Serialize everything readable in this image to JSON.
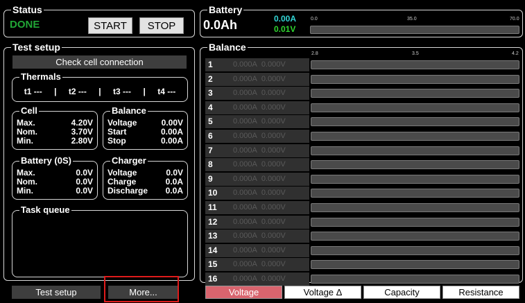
{
  "status": {
    "title": "Status",
    "state": "DONE",
    "start_label": "START",
    "stop_label": "STOP"
  },
  "battery": {
    "title": "Battery",
    "capacity": "0.0Ah",
    "current": "0.00A",
    "voltage": "0.01V",
    "scale": {
      "min": "0.0",
      "mid": "35.0",
      "max": "70.0"
    },
    "colors": {
      "current": "#32d4d4",
      "voltage": "#2fd52f"
    }
  },
  "test_setup": {
    "title": "Test setup",
    "check_button": "Check cell connection",
    "thermals": {
      "title": "Thermals",
      "t1": "t1 ---",
      "t2": "t2 ---",
      "t3": "t3 ---",
      "t4": "t4 ---",
      "sep": "|"
    },
    "cell": {
      "title": "Cell",
      "rows": [
        {
          "k": "Max.",
          "v": "4.20V"
        },
        {
          "k": "Nom.",
          "v": "3.70V"
        },
        {
          "k": "Min.",
          "v": "2.80V"
        }
      ]
    },
    "balance": {
      "title": "Balance",
      "rows": [
        {
          "k": "Voltage",
          "v": "0.00V"
        },
        {
          "k": "Start",
          "v": "0.00A"
        },
        {
          "k": "Stop",
          "v": "0.00A"
        }
      ]
    },
    "battery_cfg": {
      "title": "Battery (0S)",
      "rows": [
        {
          "k": "Max.",
          "v": "0.0V"
        },
        {
          "k": "Nom.",
          "v": "0.0V"
        },
        {
          "k": "Min.",
          "v": "0.0V"
        }
      ]
    },
    "charger": {
      "title": "Charger",
      "rows": [
        {
          "k": "Voltage",
          "v": "0.0V"
        },
        {
          "k": "Charge",
          "v": "0.0A"
        },
        {
          "k": "Discharge",
          "v": "0.0A"
        }
      ]
    },
    "task_queue": {
      "title": "Task queue"
    }
  },
  "bottom_left": {
    "test_setup_label": "Test setup",
    "more_label": "More..."
  },
  "balance_panel": {
    "title": "Balance",
    "scale": {
      "min": "2.8",
      "mid": "3.5",
      "max": "4.2"
    },
    "rows": [
      {
        "n": "1",
        "a": "0.000A",
        "v": "0.000V"
      },
      {
        "n": "2",
        "a": "0.000A",
        "v": "0.000V"
      },
      {
        "n": "3",
        "a": "0.000A",
        "v": "0.000V"
      },
      {
        "n": "4",
        "a": "0.000A",
        "v": "0.000V"
      },
      {
        "n": "5",
        "a": "0.000A",
        "v": "0.000V"
      },
      {
        "n": "6",
        "a": "0.000A",
        "v": "0.000V"
      },
      {
        "n": "7",
        "a": "0.000A",
        "v": "0.000V"
      },
      {
        "n": "8",
        "a": "0.000A",
        "v": "0.000V"
      },
      {
        "n": "9",
        "a": "0.000A",
        "v": "0.000V"
      },
      {
        "n": "10",
        "a": "0.000A",
        "v": "0.000V"
      },
      {
        "n": "11",
        "a": "0.000A",
        "v": "0.000V"
      },
      {
        "n": "12",
        "a": "0.000A",
        "v": "0.000V"
      },
      {
        "n": "13",
        "a": "0.000A",
        "v": "0.000V"
      },
      {
        "n": "14",
        "a": "0.000A",
        "v": "0.000V"
      },
      {
        "n": "15",
        "a": "0.000A",
        "v": "0.000V"
      },
      {
        "n": "16",
        "a": "0.000A",
        "v": "0.000V"
      }
    ],
    "tabs": {
      "voltage": "Voltage",
      "voltage_delta": "Voltage Δ",
      "capacity": "Capacity",
      "resistance": "Resistance"
    },
    "active_tab_color": "#d9646e"
  },
  "colors": {
    "done": "#21a636",
    "highlight": "#e01b1b"
  }
}
